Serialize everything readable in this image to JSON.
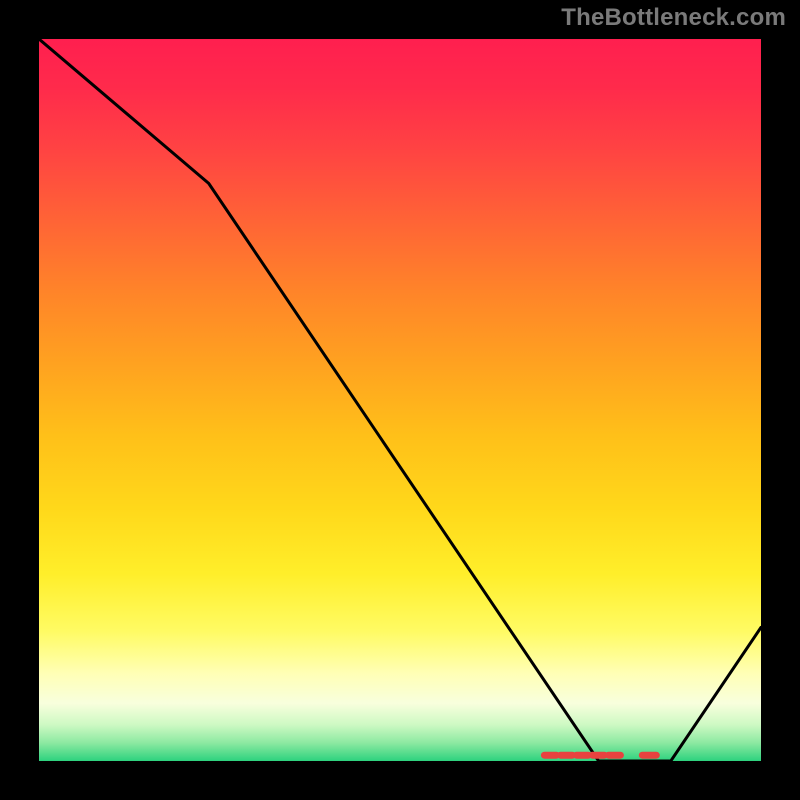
{
  "watermark": "TheBottleneck.com",
  "chart_data": {
    "type": "line",
    "title": "",
    "xlabel": "",
    "ylabel": "",
    "x_range": [
      0,
      100
    ],
    "y_range": [
      0,
      100
    ],
    "series": [
      {
        "name": "curve",
        "x": [
          0.0,
          23.5,
          77.5,
          87.5,
          100.0
        ],
        "y": [
          100.0,
          80.0,
          0.0,
          0.0,
          18.5
        ]
      }
    ],
    "markers": {
      "name": "highlight-segment",
      "color": "#e8423f",
      "style": "dashed",
      "x_start": 70.0,
      "x_end": 85.5,
      "y": 0.8
    },
    "gradient_stops": [
      {
        "pos": 0.0,
        "color": "#ff1f4f"
      },
      {
        "pos": 0.5,
        "color": "#ffc019"
      },
      {
        "pos": 0.88,
        "color": "#ffffb7"
      },
      {
        "pos": 1.0,
        "color": "#2dd27e"
      }
    ]
  }
}
